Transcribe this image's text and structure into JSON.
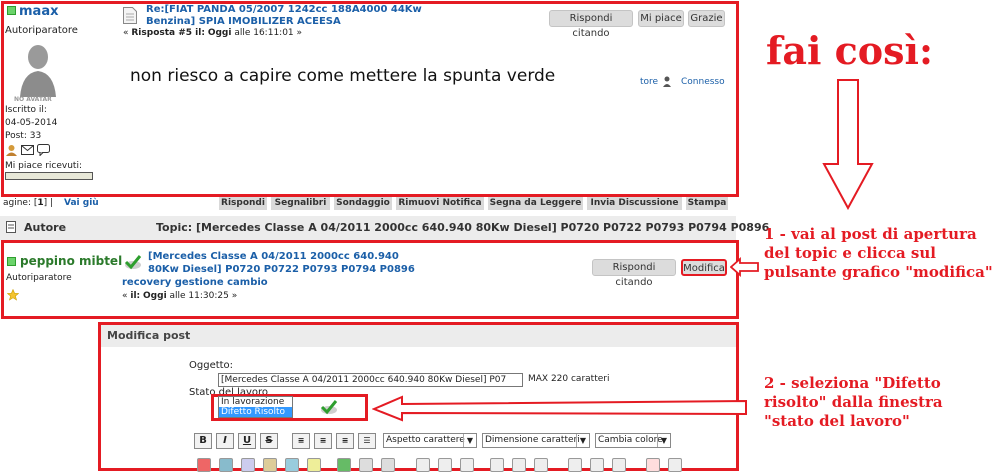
{
  "post1": {
    "username": "maax",
    "role": "Autoriparatore",
    "avatar_text": "NO AVATAR",
    "joined_label": "Iscritto il:",
    "joined_date": "04-05-2014",
    "posts": "Post: 33",
    "likes_label": "Mi piace ricevuti:",
    "title": "Re:[FIAT PANDA 05/2007 1242cc 188A4000 44Kw Benzina] SPIA IMOBILIZER ACEESA",
    "reply_prefix": "« ",
    "reply_label": "Risposta #5 il:",
    "reply_day": "Oggi",
    "reply_time": " alle 16:11:01 »",
    "body": "non riesco a capire come mettere la spunta verde",
    "buttons": {
      "quote": "Rispondi citando",
      "like": "Mi piace",
      "thanks": "Grazie"
    },
    "footer_link": "tore",
    "footer_status": "Connesso"
  },
  "nav": {
    "pages_label": "agine: [",
    "page_current": "1",
    "pages_end": "]  |",
    "go_down": "Vai giù",
    "buttons": [
      "Rispondi",
      "Segnalibri",
      "Sondaggio",
      "Rimuovi Notifica",
      "Segna da Leggere",
      "Invia Discussione",
      "Stampa"
    ]
  },
  "topic_header": {
    "author_label": "Autore",
    "topic_text": "Topic: [Mercedes Classe A 04/2011 2000cc 640.940 80Kw Diesel] P0720 P0722 P0793 P0794 P0896"
  },
  "post2": {
    "username": "peppino mibtel",
    "role": "Autoriparatore",
    "title_line1": "[Mercedes Classe A 04/2011 2000cc 640.940",
    "title_line2": "80Kw Diesel] P0720 P0722 P0793 P0794 P0896",
    "title_line3": "recovery gestione cambio",
    "meta_prefix": "« ",
    "meta_label": "il:",
    "meta_day": "Oggi",
    "meta_time": " alle 11:30:25 »",
    "buttons": {
      "quote": "Rispondi citando",
      "edit": "Modifica"
    }
  },
  "edit_form": {
    "title": "Modifica post",
    "subject_label": "Oggetto:",
    "subject_value": "[Mercedes Classe A 04/2011 2000cc 640.940 80Kw Diesel] P07",
    "max_chars": "MAX 220 caratteri",
    "status_label": "Stato del lavoro",
    "status_options": [
      "In lavorazione",
      "Difetto Risolto"
    ],
    "toolbar": {
      "bold": "B",
      "italic": "I",
      "underline": "U",
      "strike": "S"
    },
    "selects": {
      "font_face": "Aspetto carattere",
      "font_size": "Dimensione caratteri",
      "color": "Cambia colore"
    }
  },
  "annotations": {
    "headline": "fai così:",
    "step1": "1 - vai al post di apertura del topic e clicca sul pulsante grafico \"modifica\"",
    "step2": "2 - seleziona \"Difetto risolto\" dalla finestra \"stato del lavoro\""
  },
  "colors": {
    "accent": "#e41b23",
    "link": "#1b5fa8",
    "online": "#2e9e2e"
  }
}
